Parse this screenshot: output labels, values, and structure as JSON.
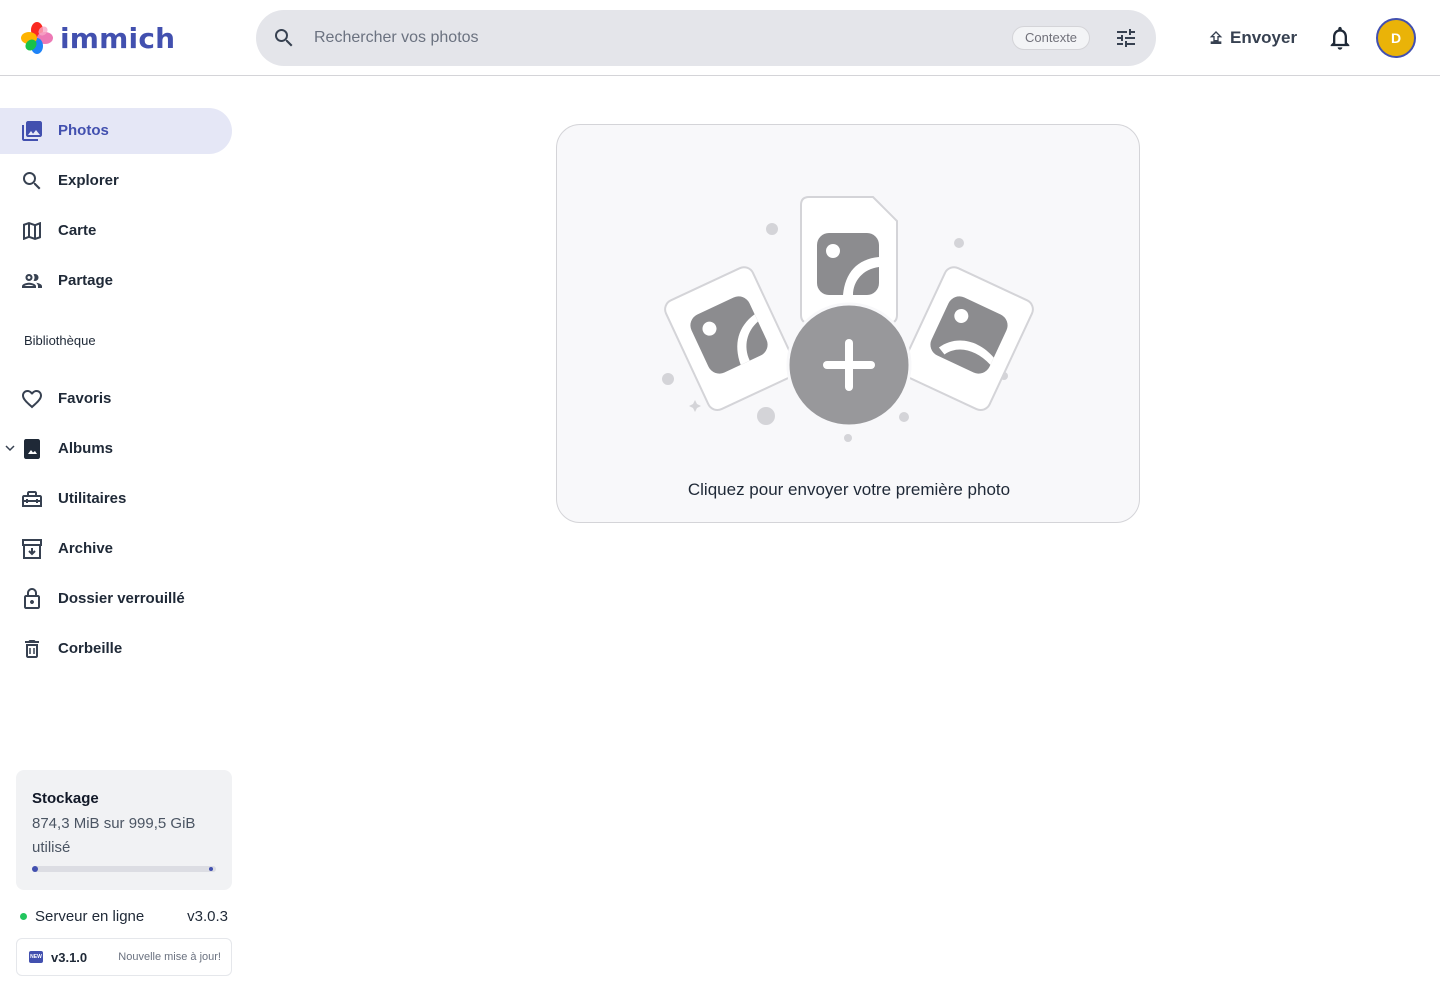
{
  "app": {
    "name": "immich",
    "brand_color": "#4250af"
  },
  "header": {
    "search_placeholder": "Rechercher vos photos",
    "context_chip": "Contexte",
    "upload_label": "Envoyer",
    "avatar_initial": "D",
    "avatar_color": "#eab308"
  },
  "sidebar": {
    "items": [
      {
        "label": "Photos",
        "icon": "photos-icon",
        "active": true
      },
      {
        "label": "Explorer",
        "icon": "search-icon"
      },
      {
        "label": "Carte",
        "icon": "map-icon"
      },
      {
        "label": "Partage",
        "icon": "people-icon"
      }
    ],
    "library_label": "Bibliothèque",
    "library_items": [
      {
        "label": "Favoris",
        "icon": "heart-icon"
      },
      {
        "label": "Albums",
        "icon": "album-icon",
        "expandable": true
      },
      {
        "label": "Utilitaires",
        "icon": "toolbox-icon"
      },
      {
        "label": "Archive",
        "icon": "archive-icon"
      },
      {
        "label": "Dossier verrouillé",
        "icon": "lock-icon"
      },
      {
        "label": "Corbeille",
        "icon": "trash-icon"
      }
    ],
    "storage": {
      "title": "Stockage",
      "usage_text": "874,3 MiB sur 999,5 GiB utilisé",
      "used_fraction": 0.001
    },
    "server": {
      "status": "Serveur en ligne",
      "version": "v3.0.3",
      "status_color": "#22c55e"
    },
    "update": {
      "badge": "NEW",
      "version": "v3.1.0",
      "text": "Nouvelle mise à jour!"
    }
  },
  "main": {
    "empty_caption": "Cliquez pour envoyer votre première photo"
  }
}
